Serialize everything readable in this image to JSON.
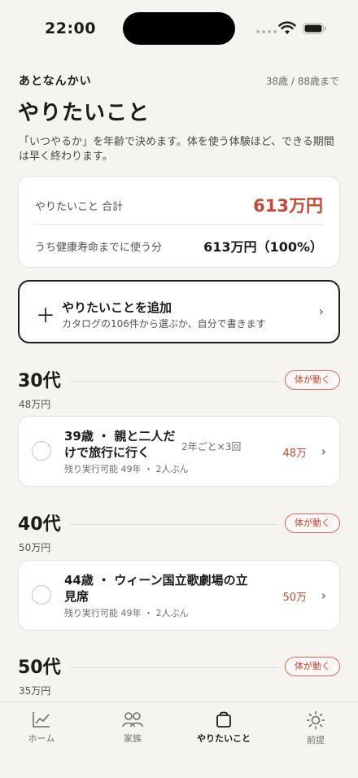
{
  "status_bar": {
    "time": "22:00"
  },
  "header": {
    "app_name": "あとなんかい",
    "age_range": "38歳 / 88歳まで"
  },
  "page": {
    "title": "やりたいこと",
    "description": "「いつやるか」を年齢で決めます。体を使う体験ほど、できる期間は早く終わります。"
  },
  "summary": {
    "total_label": "やりたいこと 合計",
    "total_value": "613万円",
    "health_label": "うち健康寿命までに使う分",
    "health_value": "613万円（100%）"
  },
  "add_card": {
    "title": "やりたいことを追加",
    "subtitle": "カタログの106件から選ぶか、自分で書きます"
  },
  "decades": [
    {
      "title": "30代",
      "badge": "体が動く",
      "total": "48万円",
      "items": [
        {
          "title": "39歳 ・ 親と二人だけで旅行に行く",
          "frequency": "2年ごと×3回",
          "meta": "残り実行可能 49年 ・ 2人ぶん",
          "price": "48万"
        }
      ]
    },
    {
      "title": "40代",
      "badge": "体が動く",
      "total": "50万円",
      "items": [
        {
          "title": "44歳 ・ ウィーン国立歌劇場の立見席",
          "frequency": "",
          "meta": "残り実行可能 49年 ・ 2人ぶん",
          "price": "50万"
        }
      ]
    },
    {
      "title": "50代",
      "badge": "体が動く",
      "total": "35万円",
      "items": []
    }
  ],
  "tabs": [
    {
      "label": "ホーム",
      "icon": "chart-line-icon"
    },
    {
      "label": "家族",
      "icon": "people-icon"
    },
    {
      "label": "やりたいこと",
      "icon": "bag-icon",
      "active": true
    },
    {
      "label": "前提",
      "icon": "sun-icon"
    }
  ],
  "colors": {
    "accent": "#c44a36",
    "background": "#f5f4f0"
  }
}
